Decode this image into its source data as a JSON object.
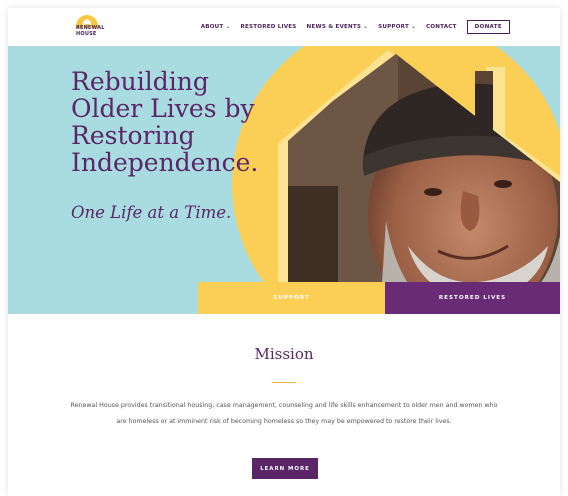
{
  "brand": {
    "name": "RENEWAL HOUSE",
    "line1": "RENEWAL",
    "line2": "HOUSE",
    "color_sun": "#f7c73e",
    "color_text": "#4a1f57"
  },
  "nav": {
    "items": [
      {
        "label": "ABOUT ⌄"
      },
      {
        "label": "RESTORED LIVES"
      },
      {
        "label": "NEWS & EVENTS ⌄"
      },
      {
        "label": "SUPPORT ⌄"
      },
      {
        "label": "CONTACT"
      }
    ],
    "donate_label": "DONATE"
  },
  "hero": {
    "title_lines": [
      "Rebuilding",
      "Older Lives by",
      "Restoring",
      "Independence."
    ],
    "subtitle": "One Life at a Time.",
    "support_label": "SUPPORT",
    "restored_label": "RESTORED LIVES",
    "colors": {
      "teal": "#a8dce0",
      "yellow": "#fbcf56",
      "purple": "#6a2b76"
    }
  },
  "mission": {
    "title": "Mission",
    "body": "Renewal House provides transitional housing, case management, counseling and life skills enhancement to older men and women who are homeless or at imminent risk of becoming homeless so they may be empowered to restore their lives.",
    "button_label": "LEARN MORE"
  }
}
